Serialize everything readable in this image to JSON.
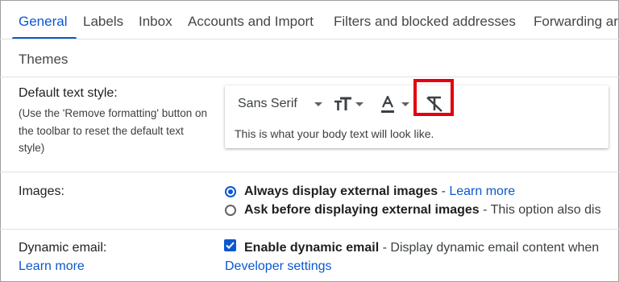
{
  "tabs": [
    {
      "label": "General"
    },
    {
      "label": "Labels"
    },
    {
      "label": "Inbox"
    },
    {
      "label": "Accounts and Import"
    },
    {
      "label": "Filters and blocked addresses"
    },
    {
      "label": "Forwarding ar"
    },
    {
      "label": "Themes"
    }
  ],
  "default_text_style": {
    "label": "Default text style:",
    "note_lines": [
      "(Use the 'Remove formatting' button on",
      "the toolbar to reset the default text",
      "style)"
    ],
    "font_name": "Sans Serif",
    "preview_text": "This is what your body text will look like."
  },
  "images": {
    "label": "Images:",
    "option1_bold": "Always display external images",
    "option1_sep": " - ",
    "option1_link": "Learn more",
    "option2_bold": "Ask before displaying external images",
    "option2_rest": " - This option also dis"
  },
  "dynamic_email": {
    "label": "Dynamic email:",
    "label_link": "Learn more",
    "checkbox_bold": "Enable dynamic email",
    "checkbox_rest": " - Display dynamic email content when",
    "dev_link": "Developer settings"
  },
  "colors": {
    "accent": "#0b57d0",
    "highlight": "#e3000f"
  }
}
